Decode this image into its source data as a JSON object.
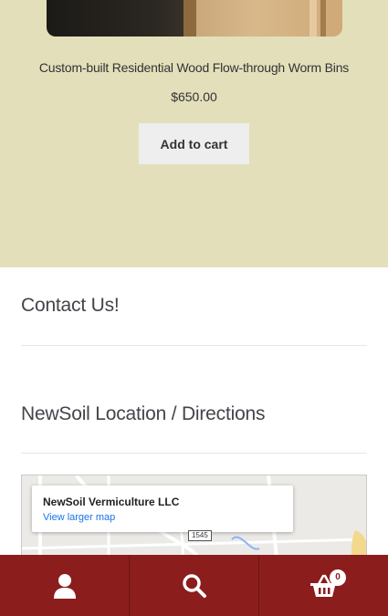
{
  "product": {
    "title": "Custom-built Residential Wood Flow-through Worm Bins",
    "price": "$650.00",
    "add_to_cart_label": "Add to cart"
  },
  "widgets": {
    "contact_title": "Contact Us!",
    "location_title": "NewSoil Location / Directions"
  },
  "map": {
    "place_name": "NewSoil Vermiculture LLC",
    "larger_map_label": "View larger map",
    "road_badge": "1545"
  },
  "bottom_bar": {
    "account_icon": "user-icon",
    "search_icon": "search-icon",
    "cart_icon": "basket-icon",
    "cart_count": "0"
  },
  "colors": {
    "product_background": "#e3dfbb",
    "bottom_bar": "#8b1d1d",
    "button_background": "#eeeeee"
  }
}
